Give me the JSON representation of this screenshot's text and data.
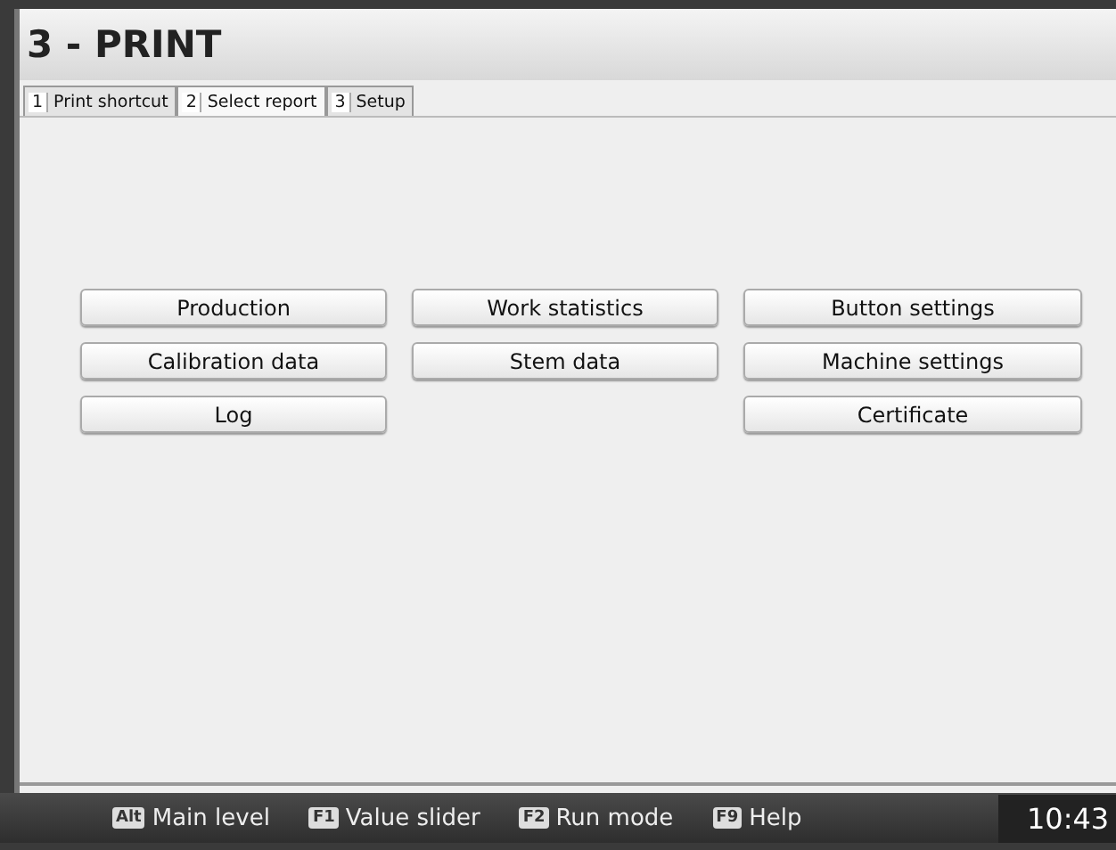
{
  "window": {
    "title": "3 - PRINT"
  },
  "tabs": [
    {
      "number": "1",
      "label": "Print shortcut",
      "selected": false
    },
    {
      "number": "2",
      "label": "Select report",
      "selected": true
    },
    {
      "number": "3",
      "label": "Setup",
      "selected": false
    }
  ],
  "report_columns": [
    [
      "Production",
      "Calibration data",
      "Log"
    ],
    [
      "Work statistics",
      "Stem data"
    ],
    [
      "Button settings",
      "Machine settings",
      "Certificate"
    ]
  ],
  "status_bar": {
    "keys": [
      {
        "key": "Alt",
        "label": "Main level"
      },
      {
        "key": "F1",
        "label": "Value slider"
      },
      {
        "key": "F2",
        "label": "Run mode"
      },
      {
        "key": "F9",
        "label": "Help"
      }
    ],
    "clock": "10:43"
  }
}
